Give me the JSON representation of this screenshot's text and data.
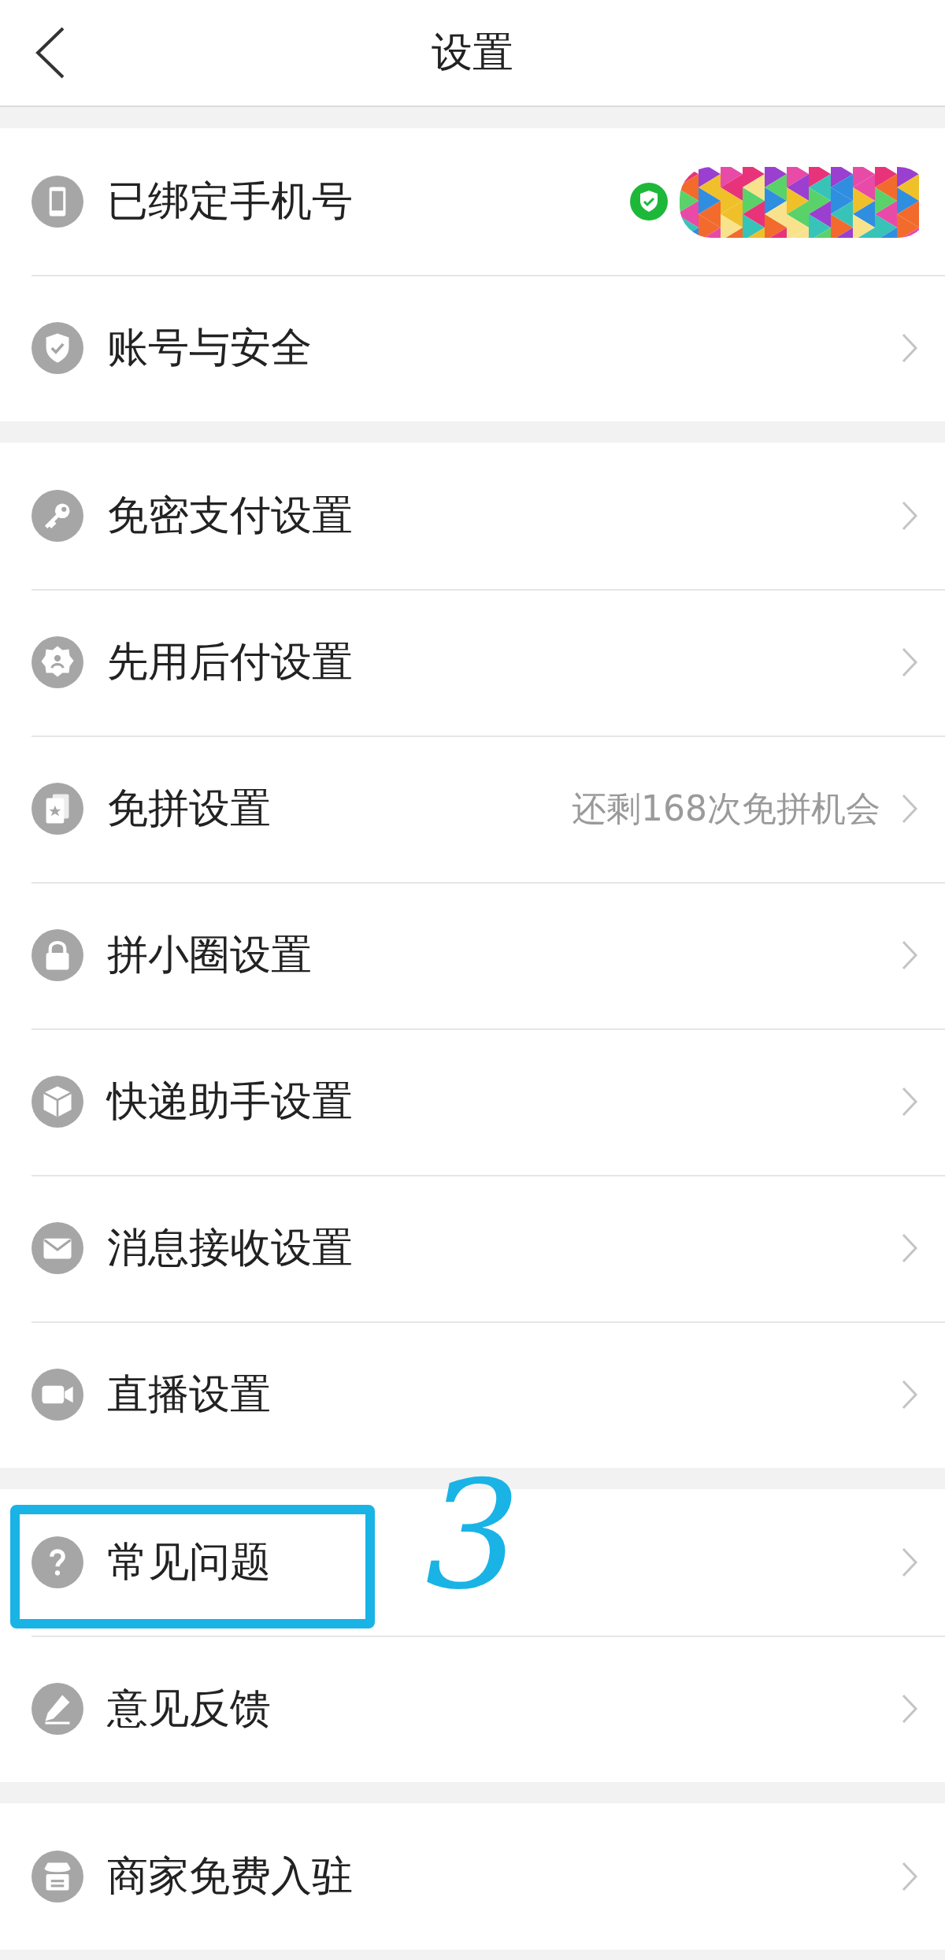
{
  "header": {
    "title": "设置"
  },
  "groups": [
    {
      "items": [
        {
          "label": "已绑定手机号",
          "kind": "verified",
          "highlighted": false
        },
        {
          "label": "账号与安全",
          "kind": "plain",
          "highlighted": false
        }
      ]
    },
    {
      "items": [
        {
          "label": "免密支付设置",
          "kind": "plain",
          "highlighted": false
        },
        {
          "label": "先用后付设置",
          "kind": "plain",
          "highlighted": false
        },
        {
          "label": "免拼设置",
          "kind": "value",
          "value": "还剩168次免拼机会",
          "highlighted": false
        },
        {
          "label": "拼小圈设置",
          "kind": "plain",
          "highlighted": false
        },
        {
          "label": "快递助手设置",
          "kind": "plain",
          "highlighted": false
        },
        {
          "label": "消息接收设置",
          "kind": "plain",
          "highlighted": false
        },
        {
          "label": "直播设置",
          "kind": "plain",
          "highlighted": false
        }
      ]
    },
    {
      "items": [
        {
          "label": "常见问题",
          "kind": "plain",
          "highlighted": true
        },
        {
          "label": "意见反馈",
          "kind": "plain",
          "highlighted": false
        }
      ]
    },
    {
      "items": [
        {
          "label": "商家免费入驻",
          "kind": "plain",
          "highlighted": false
        }
      ]
    }
  ],
  "annotation": {
    "mark": "3"
  }
}
